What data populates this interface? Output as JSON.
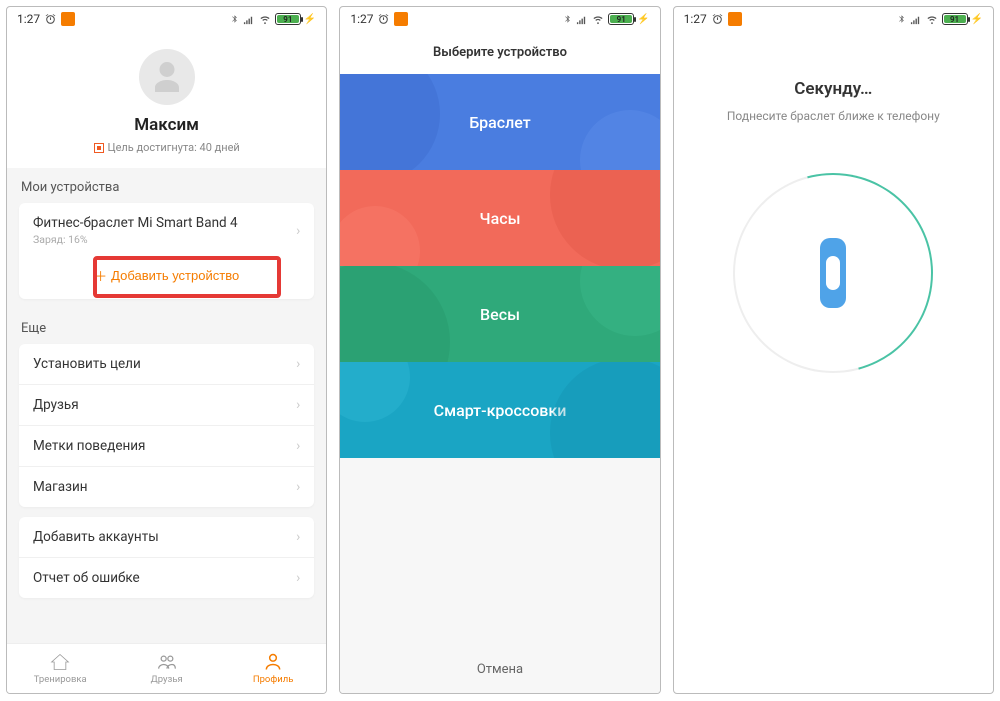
{
  "statusbar": {
    "time": "1:27",
    "battery": "91"
  },
  "screen1": {
    "username": "Максим",
    "goal_text": "Цель достигнута: 40 дней",
    "my_devices_label": "Мои устройства",
    "device": {
      "name": "Фитнес-браслет Mi Smart Band 4",
      "battery": "Заряд: 16%"
    },
    "add_device": "Добавить устройство",
    "more_label": "Еще",
    "menu": {
      "goals": "Установить цели",
      "friends": "Друзья",
      "behavior": "Метки поведения",
      "store": "Магазин",
      "accounts": "Добавить аккаунты",
      "bugreport": "Отчет об ошибке"
    },
    "nav": {
      "training": "Тренировка",
      "friends": "Друзья",
      "profile": "Профиль"
    }
  },
  "screen2": {
    "title": "Выберите устройство",
    "tiles": {
      "bracelet": "Браслет",
      "watch": "Часы",
      "scale": "Весы",
      "shoe": "Смарт-кроссовки"
    },
    "cancel": "Отмена"
  },
  "screen3": {
    "title": "Секунду…",
    "subtitle": "Поднесите браслет ближе к телефону"
  }
}
